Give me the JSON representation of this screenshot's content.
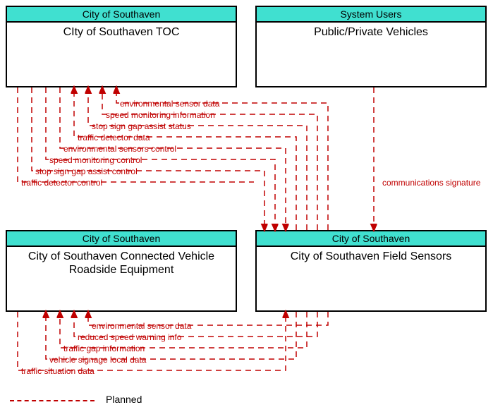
{
  "nodes": {
    "top_left": {
      "header": "City of Southaven",
      "body": "CIty of Southaven TOC"
    },
    "top_right": {
      "header": "System Users",
      "body": "Public/Private Vehicles"
    },
    "bottom_left": {
      "header": "City of Southaven",
      "body": "City of Southaven Connected Vehicle Roadside Equipment"
    },
    "bottom_right": {
      "header": "City of Southaven",
      "body": "City of Southaven Field Sensors"
    }
  },
  "flows_top": [
    "environmental sensor data",
    "speed monitoring information",
    "stop sign gap assist status",
    "traffic detector data",
    "environmental sensors control",
    "speed monitoring control",
    "stop sign gap assist control",
    "traffic detector control"
  ],
  "flows_bottom": [
    "environmental sensor data",
    "reduced speed warning info",
    "traffic gap information",
    "vehicle signage local data",
    "traffic situation data"
  ],
  "flow_right": "communications signature",
  "legend": {
    "label": "Planned"
  }
}
